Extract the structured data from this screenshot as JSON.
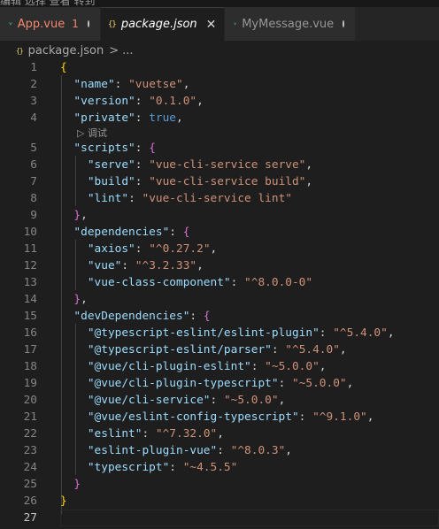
{
  "colors": {
    "vue_green": "#41b883",
    "modified_red": "#f48771",
    "json_yellow": "#f1d16b"
  },
  "top_strip_text": "编辑 选择 查看 转到",
  "tabs": [
    {
      "label": "App.vue",
      "icon": "vue-icon",
      "badge": "1",
      "state": "modified"
    },
    {
      "label": "package.json",
      "icon": "json-icon",
      "state": "active"
    },
    {
      "label": "MyMessage.vue",
      "icon": "vue-icon",
      "state": "unsaved"
    }
  ],
  "json_icon_glyph": "{}",
  "close_glyph": "✕",
  "breadcrumb": {
    "file": "package.json",
    "sep": ">",
    "more": "..."
  },
  "debug_hint": {
    "label": "调试",
    "glyph": "▷"
  },
  "current_line": 27,
  "lines": [
    {
      "n": "1",
      "tokens": [
        {
          "t": "{",
          "c": "br1"
        }
      ]
    },
    {
      "n": "2",
      "tokens": [
        {
          "t": "  "
        },
        {
          "t": "\"name\"",
          "c": "k"
        },
        {
          "t": ": ",
          "c": "p"
        },
        {
          "t": "\"vuetse\"",
          "c": "s"
        },
        {
          "t": ",",
          "c": "p"
        }
      ]
    },
    {
      "n": "3",
      "tokens": [
        {
          "t": "  "
        },
        {
          "t": "\"version\"",
          "c": "k"
        },
        {
          "t": ": ",
          "c": "p"
        },
        {
          "t": "\"0.1.0\"",
          "c": "s"
        },
        {
          "t": ",",
          "c": "p"
        }
      ]
    },
    {
      "n": "4",
      "tokens": [
        {
          "t": "  "
        },
        {
          "t": "\"private\"",
          "c": "k"
        },
        {
          "t": ": ",
          "c": "p"
        },
        {
          "t": "true",
          "c": "b"
        },
        {
          "t": ",",
          "c": "p"
        }
      ]
    },
    {
      "n": "5",
      "tokens": [
        {
          "t": "  "
        },
        {
          "t": "\"scripts\"",
          "c": "k"
        },
        {
          "t": ": ",
          "c": "p"
        },
        {
          "t": "{",
          "c": "br2"
        }
      ]
    },
    {
      "n": "6",
      "tokens": [
        {
          "t": "    "
        },
        {
          "t": "\"serve\"",
          "c": "k"
        },
        {
          "t": ": ",
          "c": "p"
        },
        {
          "t": "\"vue-cli-service serve\"",
          "c": "s"
        },
        {
          "t": ",",
          "c": "p"
        }
      ]
    },
    {
      "n": "7",
      "tokens": [
        {
          "t": "    "
        },
        {
          "t": "\"build\"",
          "c": "k"
        },
        {
          "t": ": ",
          "c": "p"
        },
        {
          "t": "\"vue-cli-service build\"",
          "c": "s"
        },
        {
          "t": ",",
          "c": "p"
        }
      ]
    },
    {
      "n": "8",
      "tokens": [
        {
          "t": "    "
        },
        {
          "t": "\"lint\"",
          "c": "k"
        },
        {
          "t": ": ",
          "c": "p"
        },
        {
          "t": "\"vue-cli-service lint\"",
          "c": "s"
        }
      ]
    },
    {
      "n": "9",
      "tokens": [
        {
          "t": "  "
        },
        {
          "t": "}",
          "c": "br2"
        },
        {
          "t": ",",
          "c": "p"
        }
      ]
    },
    {
      "n": "10",
      "tokens": [
        {
          "t": "  "
        },
        {
          "t": "\"dependencies\"",
          "c": "k"
        },
        {
          "t": ": ",
          "c": "p"
        },
        {
          "t": "{",
          "c": "br2"
        }
      ]
    },
    {
      "n": "11",
      "tokens": [
        {
          "t": "    "
        },
        {
          "t": "\"axios\"",
          "c": "k"
        },
        {
          "t": ": ",
          "c": "p"
        },
        {
          "t": "\"^0.27.2\"",
          "c": "s"
        },
        {
          "t": ",",
          "c": "p"
        }
      ]
    },
    {
      "n": "12",
      "tokens": [
        {
          "t": "    "
        },
        {
          "t": "\"vue\"",
          "c": "k"
        },
        {
          "t": ": ",
          "c": "p"
        },
        {
          "t": "\"^3.2.33\"",
          "c": "s"
        },
        {
          "t": ",",
          "c": "p"
        }
      ]
    },
    {
      "n": "13",
      "tokens": [
        {
          "t": "    "
        },
        {
          "t": "\"vue-class-component\"",
          "c": "k"
        },
        {
          "t": ": ",
          "c": "p"
        },
        {
          "t": "\"^8.0.0-0\"",
          "c": "s"
        }
      ]
    },
    {
      "n": "14",
      "tokens": [
        {
          "t": "  "
        },
        {
          "t": "}",
          "c": "br2"
        },
        {
          "t": ",",
          "c": "p"
        }
      ]
    },
    {
      "n": "15",
      "tokens": [
        {
          "t": "  "
        },
        {
          "t": "\"devDependencies\"",
          "c": "k"
        },
        {
          "t": ": ",
          "c": "p"
        },
        {
          "t": "{",
          "c": "br2"
        }
      ]
    },
    {
      "n": "16",
      "tokens": [
        {
          "t": "    "
        },
        {
          "t": "\"@typescript-eslint/eslint-plugin\"",
          "c": "k"
        },
        {
          "t": ": ",
          "c": "p"
        },
        {
          "t": "\"^5.4.0\"",
          "c": "s"
        },
        {
          "t": ",",
          "c": "p"
        }
      ]
    },
    {
      "n": "17",
      "tokens": [
        {
          "t": "    "
        },
        {
          "t": "\"@typescript-eslint/parser\"",
          "c": "k"
        },
        {
          "t": ": ",
          "c": "p"
        },
        {
          "t": "\"^5.4.0\"",
          "c": "s"
        },
        {
          "t": ",",
          "c": "p"
        }
      ]
    },
    {
      "n": "18",
      "tokens": [
        {
          "t": "    "
        },
        {
          "t": "\"@vue/cli-plugin-eslint\"",
          "c": "k"
        },
        {
          "t": ": ",
          "c": "p"
        },
        {
          "t": "\"~5.0.0\"",
          "c": "s"
        },
        {
          "t": ",",
          "c": "p"
        }
      ]
    },
    {
      "n": "19",
      "tokens": [
        {
          "t": "    "
        },
        {
          "t": "\"@vue/cli-plugin-typescript\"",
          "c": "k"
        },
        {
          "t": ": ",
          "c": "p"
        },
        {
          "t": "\"~5.0.0\"",
          "c": "s"
        },
        {
          "t": ",",
          "c": "p"
        }
      ]
    },
    {
      "n": "20",
      "tokens": [
        {
          "t": "    "
        },
        {
          "t": "\"@vue/cli-service\"",
          "c": "k"
        },
        {
          "t": ": ",
          "c": "p"
        },
        {
          "t": "\"~5.0.0\"",
          "c": "s"
        },
        {
          "t": ",",
          "c": "p"
        }
      ]
    },
    {
      "n": "21",
      "tokens": [
        {
          "t": "    "
        },
        {
          "t": "\"@vue/eslint-config-typescript\"",
          "c": "k"
        },
        {
          "t": ": ",
          "c": "p"
        },
        {
          "t": "\"^9.1.0\"",
          "c": "s"
        },
        {
          "t": ",",
          "c": "p"
        }
      ]
    },
    {
      "n": "22",
      "tokens": [
        {
          "t": "    "
        },
        {
          "t": "\"eslint\"",
          "c": "k"
        },
        {
          "t": ": ",
          "c": "p"
        },
        {
          "t": "\"^7.32.0\"",
          "c": "s"
        },
        {
          "t": ",",
          "c": "p"
        }
      ]
    },
    {
      "n": "23",
      "tokens": [
        {
          "t": "    "
        },
        {
          "t": "\"eslint-plugin-vue\"",
          "c": "k"
        },
        {
          "t": ": ",
          "c": "p"
        },
        {
          "t": "\"^8.0.3\"",
          "c": "s"
        },
        {
          "t": ",",
          "c": "p"
        }
      ]
    },
    {
      "n": "24",
      "tokens": [
        {
          "t": "    "
        },
        {
          "t": "\"typescript\"",
          "c": "k"
        },
        {
          "t": ": ",
          "c": "p"
        },
        {
          "t": "\"~4.5.5\"",
          "c": "s"
        }
      ]
    },
    {
      "n": "25",
      "tokens": [
        {
          "t": "  "
        },
        {
          "t": "}",
          "c": "br2"
        }
      ]
    },
    {
      "n": "26",
      "tokens": [
        {
          "t": "}",
          "c": "br1"
        }
      ]
    },
    {
      "n": "27",
      "tokens": []
    }
  ]
}
